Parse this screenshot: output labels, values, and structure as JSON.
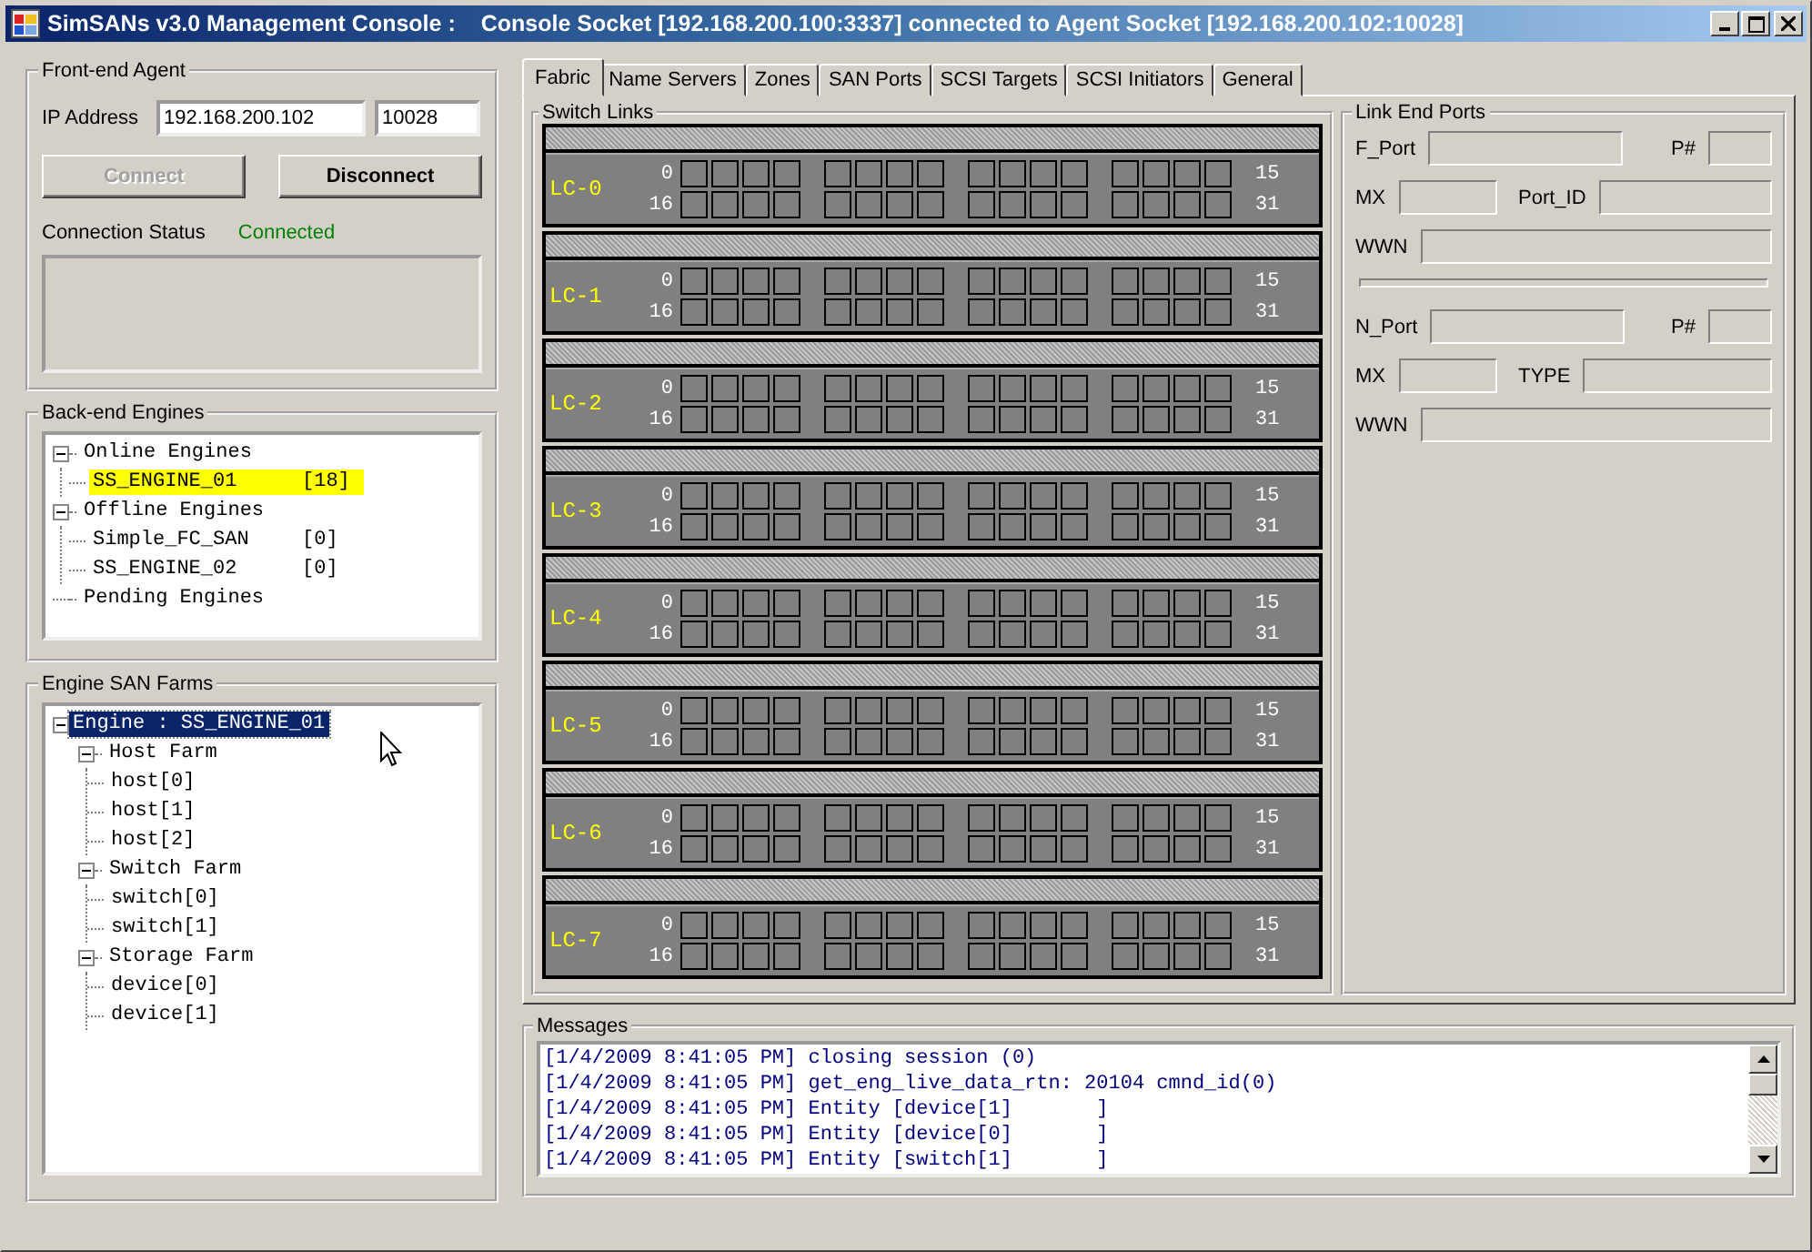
{
  "window": {
    "title": "SimSANs v3.0 Management Console :",
    "subtitle": "Console Socket [192.168.200.100:3337] connected to Agent Socket [192.168.200.102:10028]"
  },
  "front_end_agent": {
    "title": "Front-end Agent",
    "ip_label": "IP Address",
    "ip_value": "192.168.200.102",
    "port_value": "10028",
    "buttons": [
      {
        "label": "Connect",
        "disabled": true
      },
      {
        "label": "Disconnect",
        "disabled": false
      }
    ],
    "status_label": "Connection Status",
    "status_value": "Connected"
  },
  "back_end_engines": {
    "title": "Back-end Engines",
    "tree": [
      {
        "label": "Online Engines",
        "expanded": true,
        "highlighted": false,
        "children": [
          {
            "label": "SS_ENGINE_01",
            "count": "[18]",
            "highlighted": true
          }
        ]
      },
      {
        "label": "Offline Engines",
        "expanded": true,
        "highlighted": false,
        "children": [
          {
            "label": "Simple_FC_SAN",
            "count": "[0]",
            "highlighted": false
          },
          {
            "label": "SS_ENGINE_02",
            "count": "[0]",
            "highlighted": false
          }
        ]
      },
      {
        "label": "Pending Engines",
        "highlighted": false
      }
    ]
  },
  "engine_san_farms": {
    "title": "Engine SAN Farms",
    "tree": [
      {
        "label": "Engine : SS_ENGINE_01",
        "expanded": true,
        "selected": true,
        "children": [
          {
            "label": "Host Farm",
            "expanded": true,
            "selected": false,
            "children": [
              {
                "label": "host[0]",
                "selected": false
              },
              {
                "label": "host[1]",
                "selected": false
              },
              {
                "label": "host[2]",
                "selected": false
              }
            ]
          },
          {
            "label": "Switch Farm",
            "expanded": true,
            "selected": false,
            "children": [
              {
                "label": "switch[0]",
                "selected": false
              },
              {
                "label": "switch[1]",
                "selected": false
              }
            ]
          },
          {
            "label": "Storage Farm",
            "expanded": true,
            "selected": false,
            "children": [
              {
                "label": "device[0]",
                "selected": false
              },
              {
                "label": "device[1]",
                "selected": false
              }
            ]
          }
        ]
      }
    ]
  },
  "tabs": [
    {
      "label": "Fabric",
      "selected": true
    },
    {
      "label": "Name Servers",
      "selected": false
    },
    {
      "label": "Zones",
      "selected": false
    },
    {
      "label": "SAN Ports",
      "selected": false
    },
    {
      "label": "SCSI Targets",
      "selected": false
    },
    {
      "label": "SCSI Initiators",
      "selected": false
    },
    {
      "label": "General",
      "selected": false
    }
  ],
  "switch_links": {
    "title": "Switch Links",
    "cards": [
      {
        "name": "LC-0",
        "row_starts": [
          "0",
          "16"
        ],
        "row_ends": [
          "15",
          "31"
        ]
      },
      {
        "name": "LC-1",
        "row_starts": [
          "0",
          "16"
        ],
        "row_ends": [
          "15",
          "31"
        ]
      },
      {
        "name": "LC-2",
        "row_starts": [
          "0",
          "16"
        ],
        "row_ends": [
          "15",
          "31"
        ]
      },
      {
        "name": "LC-3",
        "row_starts": [
          "0",
          "16"
        ],
        "row_ends": [
          "15",
          "31"
        ]
      },
      {
        "name": "LC-4",
        "row_starts": [
          "0",
          "16"
        ],
        "row_ends": [
          "15",
          "31"
        ]
      },
      {
        "name": "LC-5",
        "row_starts": [
          "0",
          "16"
        ],
        "row_ends": [
          "15",
          "31"
        ]
      },
      {
        "name": "LC-6",
        "row_starts": [
          "0",
          "16"
        ],
        "row_ends": [
          "15",
          "31"
        ]
      },
      {
        "name": "LC-7",
        "row_starts": [
          "0",
          "16"
        ],
        "row_ends": [
          "15",
          "31"
        ]
      }
    ]
  },
  "link_end_ports": {
    "title": "Link End Ports",
    "sections": [
      {
        "rows": [
          {
            "fields": [
              {
                "label": "F_Port",
                "kind": "long"
              },
              {
                "label": "P#",
                "kind": "short"
              }
            ]
          },
          {
            "fields": [
              {
                "label": "MX",
                "kind": "small"
              },
              {
                "label": "Port_ID",
                "kind": "fill"
              }
            ]
          },
          {
            "fields": [
              {
                "label": "WWN",
                "kind": "fill"
              }
            ]
          }
        ]
      },
      {
        "rows": [
          {
            "fields": [
              {
                "label": "N_Port",
                "kind": "long"
              },
              {
                "label": "P#",
                "kind": "short"
              }
            ]
          },
          {
            "fields": [
              {
                "label": "MX",
                "kind": "small"
              },
              {
                "label": "TYPE",
                "kind": "fill"
              }
            ]
          },
          {
            "fields": [
              {
                "label": "WWN",
                "kind": "fill"
              }
            ]
          }
        ]
      }
    ]
  },
  "messages": {
    "title": "Messages",
    "lines": [
      "[1/4/2009 8:41:05 PM] closing session (0)",
      "[1/4/2009 8:41:05 PM] get_eng_live_data_rtn: 20104 cmnd_id(0)",
      "[1/4/2009 8:41:05 PM] Entity [device[1]       ]",
      "[1/4/2009 8:41:05 PM] Entity [device[0]       ]",
      "[1/4/2009 8:41:05 PM] Entity [switch[1]       ]"
    ]
  }
}
